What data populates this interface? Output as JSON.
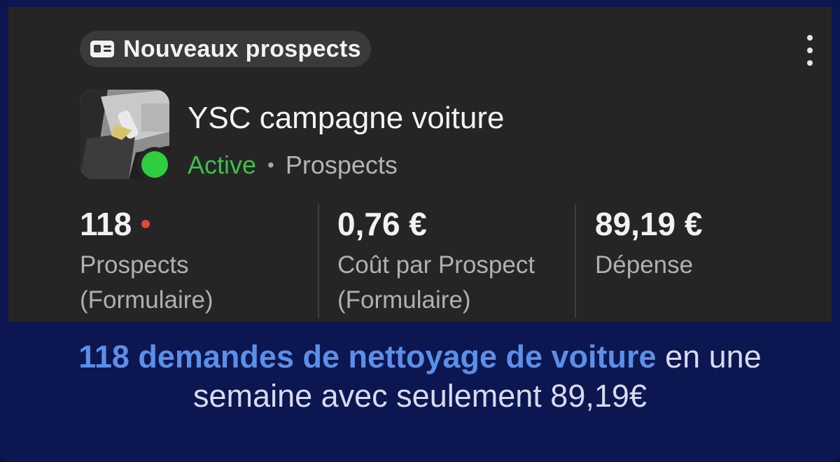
{
  "card": {
    "badge_label": "Nouveaux prospects",
    "badge_icon": "id-card-icon",
    "menu_icon": "more-vertical-icon",
    "campaign": {
      "title": "YSC campagne voiture",
      "status": "Active",
      "separator": "•",
      "objective": "Prospects",
      "status_color": "#3fbf4a"
    },
    "metrics": [
      {
        "value": "118",
        "label_line1": "Prospects",
        "label_line2": "(Formulaire)",
        "indicator_color": "#e0453a"
      },
      {
        "value": "0,76 €",
        "label_line1": "Coût par Prospect",
        "label_line2": "(Formulaire)"
      },
      {
        "value": "89,19 €",
        "label_line1": "Dépense",
        "label_line2": ""
      }
    ]
  },
  "caption": {
    "highlight": "118 demandes de nettoyage de voiture",
    "rest_line1": " en une",
    "line2": "semaine avec seulement 89,19€",
    "highlight_color": "#5b8fe8"
  }
}
